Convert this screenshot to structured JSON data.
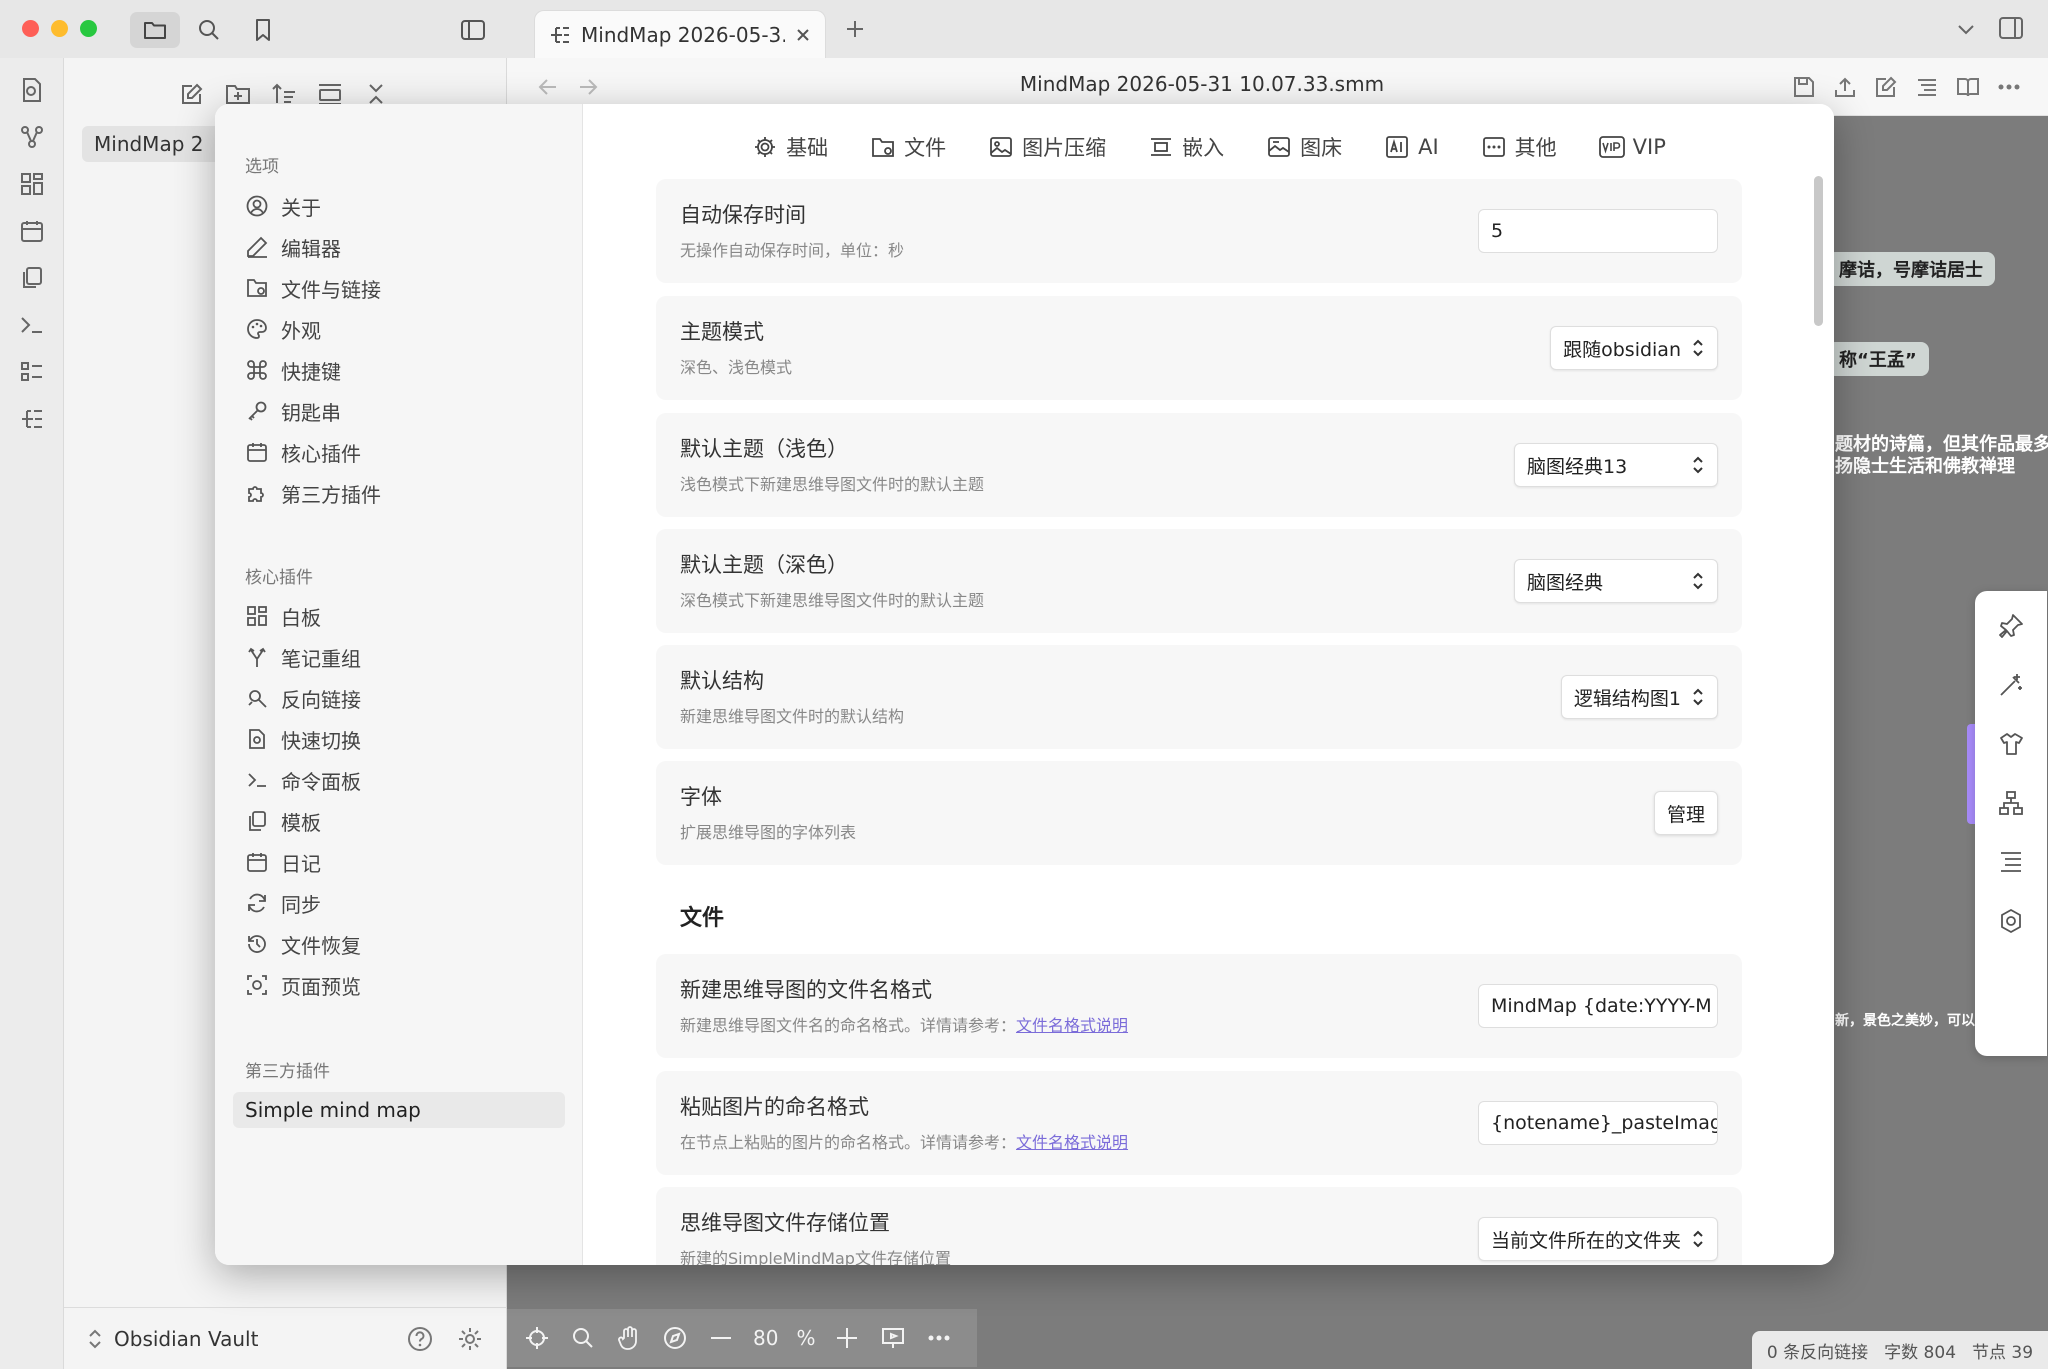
{
  "window": {
    "tab_title": "MindMap 2026-05-3...",
    "file_title": "MindMap 2026-05-31 10.07.33.smm"
  },
  "left_pane": {
    "file_item": "MindMap 2",
    "vault_name": "Obsidian Vault"
  },
  "canvas": {
    "nodes": [
      "摩诘，号摩诘居士",
      "称“王孟”"
    ],
    "text_lines": [
      "题材的诗篇，但其作品最多",
      "扬隐士生活和佛教禅理",
      "新，景色之美妙，可以想见"
    ],
    "zoom_value": "80",
    "zoom_unit": "%"
  },
  "statusbar": {
    "backlinks": "0 条反向链接",
    "word_count": "字数 804",
    "node_count": "节点 39"
  },
  "settings_nav": {
    "section_options": "选项",
    "options_items": [
      "关于",
      "编辑器",
      "文件与链接",
      "外观",
      "快捷键",
      "钥匙串",
      "核心插件",
      "第三方插件"
    ],
    "section_core": "核心插件",
    "core_items": [
      "白板",
      "笔记重组",
      "反向链接",
      "快速切换",
      "命令面板",
      "模板",
      "日记",
      "同步",
      "文件恢复",
      "页面预览"
    ],
    "section_third": "第三方插件",
    "third_items": [
      "Simple mind map"
    ]
  },
  "settings_tabs": [
    "基础",
    "文件",
    "图片压缩",
    "嵌入",
    "图床",
    "AI",
    "其他",
    "VIP"
  ],
  "settings_rows": [
    {
      "title": "自动保存时间",
      "desc": "无操作自动保存时间，单位：秒",
      "control": "input",
      "value": "5"
    },
    {
      "title": "主题模式",
      "desc": "深色、浅色模式",
      "control": "select",
      "value": "跟随obsidian"
    },
    {
      "title": "默认主题（浅色）",
      "desc": "浅色模式下新建思维导图文件时的默认主题",
      "control": "select",
      "value": "脑图经典13"
    },
    {
      "title": "默认主题（深色）",
      "desc": "深色模式下新建思维导图文件时的默认主题",
      "control": "select",
      "value": "脑图经典"
    },
    {
      "title": "默认结构",
      "desc": "新建思维导图文件时的默认结构",
      "control": "select",
      "value": "逻辑结构图1"
    },
    {
      "title": "字体",
      "desc": "扩展思维导图的字体列表",
      "control": "button",
      "value": "管理"
    }
  ],
  "file_section": {
    "heading": "文件",
    "rows": [
      {
        "title": "新建思维导图的文件名格式",
        "desc": "新建思维导图文件名的命名格式。详情请参考：",
        "link": "文件名格式说明",
        "control": "input",
        "value": "MindMap {date:YYYY-M"
      },
      {
        "title": "粘贴图片的命名格式",
        "desc": "在节点上粘贴的图片的命名格式。详情请参考：",
        "link": "文件名格式说明",
        "control": "input",
        "value": "{notename}_pasteImage"
      },
      {
        "title": "思维导图文件存储位置",
        "desc": "新建的SimpleMindMap文件存储位置",
        "control": "select",
        "value": "当前文件所在的文件夹"
      }
    ]
  },
  "colors": {
    "accent": "#7b6cd9",
    "purple_tab": "#a78bfa",
    "canvas_bg": "#7c7c7c"
  }
}
